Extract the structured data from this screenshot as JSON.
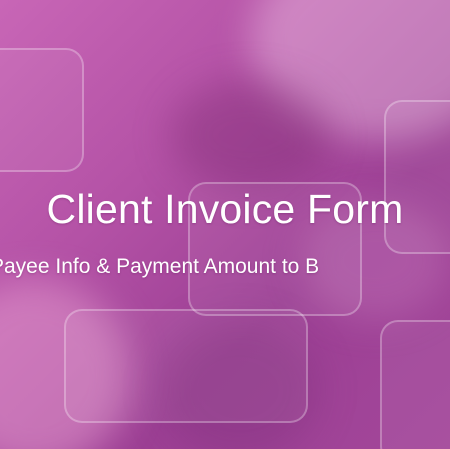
{
  "hero": {
    "title": "Client Invoice Form",
    "subtitle": "Payee Info & Payment Amount to B"
  },
  "colors": {
    "background": "#b452a6",
    "text": "#ffffff"
  }
}
